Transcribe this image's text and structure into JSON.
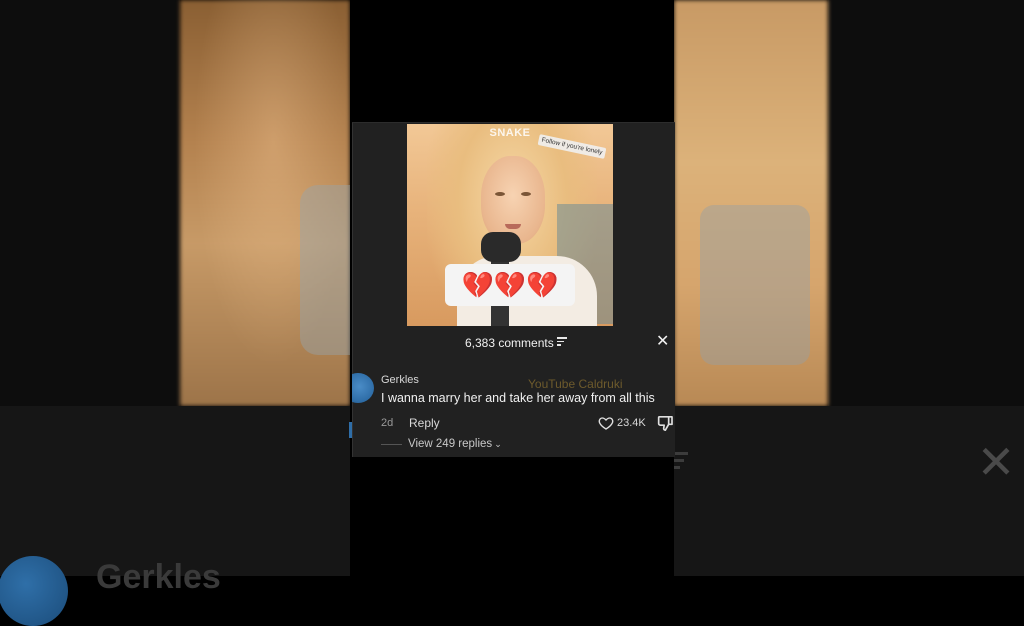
{
  "video": {
    "watermark_top": "SNAKE",
    "sticker": "Follow if you're lonely",
    "emoji_caption": "💔💔💔"
  },
  "comments_header": {
    "count_label": "6,383 comments",
    "filter_icon": "sort-filter-icon",
    "close_icon": "close-icon"
  },
  "comment": {
    "author": "Gerkles",
    "text": "I wanna marry her and take her away from all this",
    "age": "2d",
    "reply_label": "Reply",
    "likes": "23.4K",
    "view_replies": "View 249 replies",
    "chevron": "⌄"
  },
  "overlay_watermark": "YouTube Caldruki",
  "background_echo": {
    "author": "Gerkles",
    "close_glyph": "✕"
  },
  "colors": {
    "panel_bg": "#212121",
    "text_primary": "#f1f1f1",
    "text_secondary": "#9a9a9a",
    "avatar_blue": "#2f6ea8"
  }
}
